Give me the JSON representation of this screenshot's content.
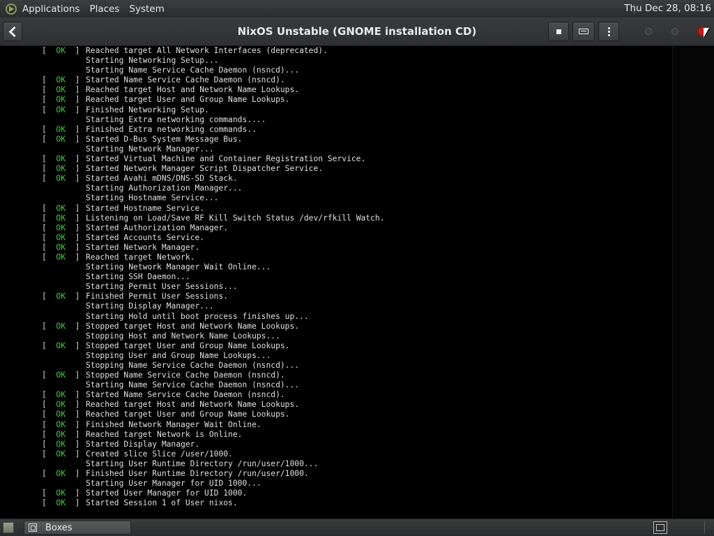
{
  "top_panel": {
    "menus": [
      "Applications",
      "Places",
      "System"
    ],
    "clock": "Thu Dec 28, 08:16"
  },
  "window": {
    "title": "NixOS Unstable (GNOME installation CD)"
  },
  "console": {
    "lines": [
      {
        "status": "OK",
        "verb": "Reached target",
        "text": "All Network Interfaces (deprecated)."
      },
      {
        "status": "",
        "verb": "Starting",
        "text": "Networking Setup..."
      },
      {
        "status": "",
        "verb": "Starting",
        "text": "Name Service Cache Daemon (nsncd)..."
      },
      {
        "status": "OK",
        "verb": "Started",
        "text": "Name Service Cache Daemon (nsncd)."
      },
      {
        "status": "OK",
        "verb": "Reached target",
        "text": "Host and Network Name Lookups."
      },
      {
        "status": "OK",
        "verb": "Reached target",
        "text": "User and Group Name Lookups."
      },
      {
        "status": "OK",
        "verb": "Finished",
        "text": "Networking Setup."
      },
      {
        "status": "",
        "verb": "Starting",
        "text": "Extra networking commands...."
      },
      {
        "status": "OK",
        "verb": "Finished",
        "text": "Extra networking commands.."
      },
      {
        "status": "OK",
        "verb": "Started",
        "text": "D-Bus System Message Bus."
      },
      {
        "status": "",
        "verb": "Starting",
        "text": "Network Manager..."
      },
      {
        "status": "OK",
        "verb": "Started",
        "text": "Virtual Machine and Container Registration Service."
      },
      {
        "status": "OK",
        "verb": "Started",
        "text": "Network Manager Script Dispatcher Service."
      },
      {
        "status": "OK",
        "verb": "Started",
        "text": "Avahi mDNS/DNS-SD Stack."
      },
      {
        "status": "",
        "verb": "Starting",
        "text": "Authorization Manager..."
      },
      {
        "status": "",
        "verb": "Starting",
        "text": "Hostname Service..."
      },
      {
        "status": "OK",
        "verb": "Started",
        "text": "Hostname Service."
      },
      {
        "status": "OK",
        "verb": "Listening on",
        "text": "Load/Save RF Kill Switch Status /dev/rfkill Watch."
      },
      {
        "status": "OK",
        "verb": "Started",
        "text": "Authorization Manager."
      },
      {
        "status": "OK",
        "verb": "Started",
        "text": "Accounts Service."
      },
      {
        "status": "OK",
        "verb": "Started",
        "text": "Network Manager."
      },
      {
        "status": "OK",
        "verb": "Reached target",
        "text": "Network."
      },
      {
        "status": "",
        "verb": "Starting",
        "text": "Network Manager Wait Online..."
      },
      {
        "status": "",
        "verb": "Starting",
        "text": "SSH Daemon..."
      },
      {
        "status": "",
        "verb": "Starting",
        "text": "Permit User Sessions..."
      },
      {
        "status": "OK",
        "verb": "Finished",
        "text": "Permit User Sessions."
      },
      {
        "status": "",
        "verb": "Starting",
        "text": "Display Manager..."
      },
      {
        "status": "",
        "verb": "Starting",
        "text": "Hold until boot process finishes up..."
      },
      {
        "status": "OK",
        "verb": "Stopped target",
        "text": "Host and Network Name Lookups."
      },
      {
        "status": "",
        "verb": "Stopping",
        "text": "Host and Network Name Lookups..."
      },
      {
        "status": "OK",
        "verb": "Stopped target",
        "text": "User and Group Name Lookups."
      },
      {
        "status": "",
        "verb": "Stopping",
        "text": "User and Group Name Lookups..."
      },
      {
        "status": "",
        "verb": "Stopping",
        "text": "Name Service Cache Daemon (nsncd)..."
      },
      {
        "status": "OK",
        "verb": "Stopped",
        "text": "Name Service Cache Daemon (nsncd)."
      },
      {
        "status": "",
        "verb": "Starting",
        "text": "Name Service Cache Daemon (nsncd)..."
      },
      {
        "status": "OK",
        "verb": "Started",
        "text": "Name Service Cache Daemon (nsncd)."
      },
      {
        "status": "OK",
        "verb": "Reached target",
        "text": "Host and Network Name Lookups."
      },
      {
        "status": "OK",
        "verb": "Reached target",
        "text": "User and Group Name Lookups."
      },
      {
        "status": "OK",
        "verb": "Finished",
        "text": "Network Manager Wait Online."
      },
      {
        "status": "OK",
        "verb": "Reached target",
        "text": "Network is Online."
      },
      {
        "status": "OK",
        "verb": "Started",
        "text": "Display Manager."
      },
      {
        "status": "OK",
        "verb": "Created slice",
        "text": "Slice /user/1000."
      },
      {
        "status": "",
        "verb": "Starting",
        "text": "User Runtime Directory /run/user/1000..."
      },
      {
        "status": "OK",
        "verb": "Finished",
        "text": "User Runtime Directory /run/user/1000."
      },
      {
        "status": "",
        "verb": "Starting",
        "text": "User Manager for UID 1000..."
      },
      {
        "status": "OK",
        "verb": "Started",
        "text": "User Manager for UID 1000."
      },
      {
        "status": "OK",
        "verb": "Started",
        "text": "Session 1 of User nixos."
      }
    ]
  },
  "taskbar": {
    "items": [
      {
        "label": "Boxes",
        "icon": "boxes-icon"
      }
    ]
  },
  "colors": {
    "ok": "#3bd13b",
    "panel": "#2f3031",
    "close": "#c41c1c"
  }
}
